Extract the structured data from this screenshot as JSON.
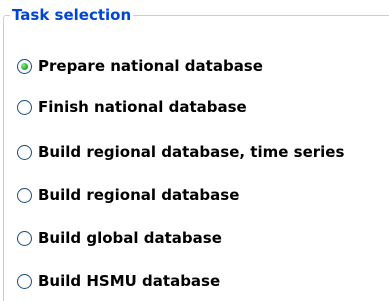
{
  "group": {
    "title": "Task selection"
  },
  "options": [
    {
      "label": "Prepare national database",
      "checked": true
    },
    {
      "label": "Finish national database",
      "checked": false
    },
    {
      "label": "Build regional database, time series",
      "checked": false
    },
    {
      "label": "Build regional database",
      "checked": false
    },
    {
      "label": "Build global database",
      "checked": false
    },
    {
      "label": "Build HSMU database",
      "checked": false
    }
  ],
  "colors": {
    "title": "#0046d5",
    "border": "#d0d0bf",
    "radio_border": "#1c5180",
    "radio_dot": "#21a121"
  }
}
